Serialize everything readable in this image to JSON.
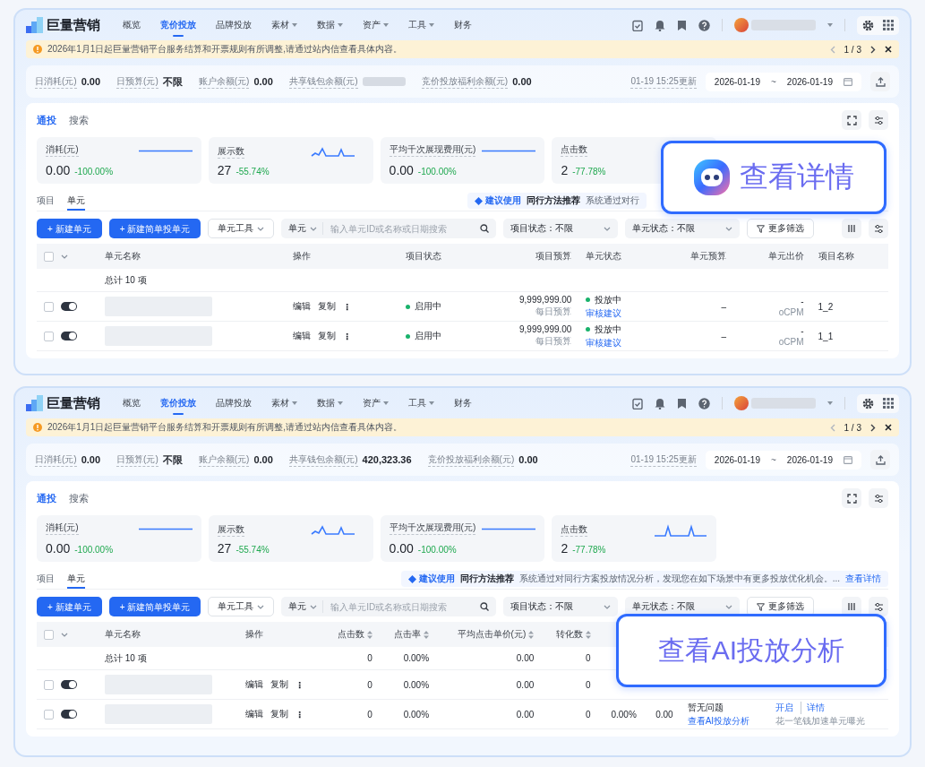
{
  "panels": [
    {
      "nav": {
        "logo": "巨量营销",
        "items": [
          {
            "label": "概览",
            "selected": false,
            "dropdown": false
          },
          {
            "label": "竞价投放",
            "selected": true,
            "dropdown": false
          },
          {
            "label": "品牌投放",
            "selected": false,
            "dropdown": false
          },
          {
            "label": "素材",
            "selected": false,
            "dropdown": true
          },
          {
            "label": "数据",
            "selected": false,
            "dropdown": true
          },
          {
            "label": "资产",
            "selected": false,
            "dropdown": true
          },
          {
            "label": "工具",
            "selected": false,
            "dropdown": true
          },
          {
            "label": "财务",
            "selected": false,
            "dropdown": false
          }
        ]
      },
      "notice": {
        "text": "2026年1月1日起巨量营销平台服务结算和开票规则有所调整,请通过站内信查看具体内容。",
        "pager": "1 / 3"
      },
      "stats": [
        {
          "label": "日消耗(元)",
          "value": "0.00"
        },
        {
          "label": "日预算(元)",
          "value": "不限"
        },
        {
          "label": "账户余额(元)",
          "value": "0.00"
        },
        {
          "label": "共享钱包余额(元)",
          "blurred": true
        },
        {
          "label": "竞价投放福利余额(元)",
          "value": "0.00"
        }
      ],
      "updated": "01-19 15:25更新",
      "date_start": "2026-01-19",
      "date_sep": "~",
      "date_end": "2026-01-19",
      "channel_tabs": [
        {
          "label": "通投",
          "selected": true
        },
        {
          "label": "搜索",
          "selected": false
        }
      ],
      "metrics": [
        {
          "label": "消耗(元)",
          "value": "0.00",
          "change": "-100.00%",
          "kind": "flat"
        },
        {
          "label": "展示数",
          "value": "27",
          "change": "-55.74%",
          "kind": "wave"
        },
        {
          "label": "平均千次展现费用(元)",
          "value": "0.00",
          "change": "-100.00%",
          "kind": "flat"
        },
        {
          "label": "点击数",
          "value": "2",
          "change": "-77.78%"
        }
      ],
      "level_tabs": [
        {
          "label": "项目",
          "selected": false
        },
        {
          "label": "单元",
          "selected": true
        }
      ],
      "suggestion": {
        "tag": "建议使用",
        "title": "同行方法推荐",
        "text": "系统通过对行"
      },
      "toolbar": {
        "primary": [
          "+ 新建单元",
          "+ 新建简单投单元"
        ],
        "tools": "单元工具",
        "scope": "单元",
        "placeholder": "输入单元ID或名称或日期搜索",
        "filters": [
          "项目状态：不限",
          "单元状态：不限"
        ],
        "more": "更多筛选"
      },
      "table": {
        "select_all_checked": false,
        "columns": [
          {
            "label": "单元名称",
            "kind": "name"
          },
          {
            "label": "操作",
            "kind": "ops"
          },
          {
            "label": "项目状态",
            "kind": "text"
          },
          {
            "label": "项目预算",
            "kind": "num"
          },
          {
            "label": "单元状态",
            "kind": "text"
          },
          {
            "label": "单元预算",
            "kind": "num"
          },
          {
            "label": "单元出价",
            "kind": "num"
          },
          {
            "label": "项目名称",
            "kind": "text"
          }
        ],
        "total": {
          "label": "总计 10 项"
        },
        "rows": [
          {
            "checked": false,
            "on": true,
            "cells": [
              {
                "blurred": true
              },
              {
                "links": [
                  "编辑",
                  "复制"
                ],
                "more": "⋮"
              },
              {
                "status": "启用中",
                "color": "#19b26b"
              },
              {
                "main": "9,999,999.00",
                "sub": "每日预算"
              },
              {
                "status": "投放中",
                "color": "#19b26b",
                "link": "审核建议"
              },
              "–",
              {
                "main": "-",
                "sub": "oCPM"
              },
              "1_2"
            ]
          },
          {
            "checked": false,
            "on": true,
            "cells": [
              {
                "blurred": true
              },
              {
                "links": [
                  "编辑",
                  "复制"
                ],
                "more": "⋮"
              },
              {
                "status": "启用中",
                "color": "#19b26b"
              },
              {
                "main": "9,999,999.00",
                "sub": "每日预算"
              },
              {
                "status": "投放中",
                "color": "#19b26b",
                "link": "审核建议"
              },
              "–",
              {
                "main": "-",
                "sub": "oCPM"
              },
              "1_1"
            ]
          }
        ]
      },
      "callout": {
        "text": "查看详情",
        "icon": true
      }
    },
    {
      "nav": {
        "logo": "巨量营销",
        "items": [
          {
            "label": "概览",
            "selected": false,
            "dropdown": false
          },
          {
            "label": "竞价投放",
            "selected": true,
            "dropdown": false
          },
          {
            "label": "品牌投放",
            "selected": false,
            "dropdown": false
          },
          {
            "label": "素材",
            "selected": false,
            "dropdown": true
          },
          {
            "label": "数据",
            "selected": false,
            "dropdown": true
          },
          {
            "label": "资产",
            "selected": false,
            "dropdown": true
          },
          {
            "label": "工具",
            "selected": false,
            "dropdown": true
          },
          {
            "label": "财务",
            "selected": false,
            "dropdown": false
          }
        ]
      },
      "notice": {
        "text": "2026年1月1日起巨量营销平台服务结算和开票规则有所调整,请通过站内信查看具体内容。",
        "pager": "1 / 3"
      },
      "stats": [
        {
          "label": "日消耗(元)",
          "value": "0.00"
        },
        {
          "label": "日预算(元)",
          "value": "不限"
        },
        {
          "label": "账户余额(元)",
          "value": "0.00"
        },
        {
          "label": "共享钱包余额(元)",
          "value": "420,323.36"
        },
        {
          "label": "竞价投放福利余额(元)",
          "value": "0.00"
        }
      ],
      "updated": "01-19 15:25更新",
      "date_start": "2026-01-19",
      "date_sep": "~",
      "date_end": "2026-01-19",
      "channel_tabs": [
        {
          "label": "通投",
          "selected": true
        },
        {
          "label": "搜索",
          "selected": false
        }
      ],
      "metrics": [
        {
          "label": "消耗(元)",
          "value": "0.00",
          "change": "-100.00%",
          "kind": "flat"
        },
        {
          "label": "展示数",
          "value": "27",
          "change": "-55.74%",
          "kind": "wave"
        },
        {
          "label": "平均千次展现费用(元)",
          "value": "0.00",
          "change": "-100.00%",
          "kind": "flat"
        },
        {
          "label": "点击数",
          "value": "2",
          "change": "-77.78%",
          "kind": "peaks"
        }
      ],
      "level_tabs": [
        {
          "label": "项目",
          "selected": false
        },
        {
          "label": "单元",
          "selected": true
        }
      ],
      "suggestion": {
        "tag": "建议使用",
        "title": "同行方法推荐",
        "text": "系统通过对同行方案投放情况分析，发现您在如下场景中有更多投放优化机会。...",
        "link": "查看详情"
      },
      "toolbar": {
        "primary": [
          "+ 新建单元",
          "+ 新建简单投单元"
        ],
        "tools": "单元工具",
        "scope": "单元",
        "placeholder": "输入单元ID或名称或日期搜索",
        "filters": [
          "项目状态：不限",
          "单元状态：不限"
        ],
        "more": "更多筛选"
      },
      "table": {
        "select_all_checked": false,
        "columns": [
          {
            "label": "单元名称",
            "kind": "name"
          },
          {
            "label": "操作",
            "kind": "ops"
          },
          {
            "label": "点击数",
            "kind": "num",
            "sortable": true
          },
          {
            "label": "点击率",
            "kind": "num",
            "sortable": true
          },
          {
            "label": "平均点击单价(元)",
            "kind": "num",
            "sortable": true
          },
          {
            "label": "转化数",
            "kind": "num",
            "sortable": true
          },
          {
            "kind": "num"
          },
          {
            "kind": "num"
          },
          {
            "kind": "text"
          },
          {
            "kind": "text"
          }
        ],
        "total": {
          "label": "总计 10 项",
          "values": [
            "0",
            "0.00%",
            "0.00",
            "0"
          ]
        },
        "rows": [
          {
            "checked": false,
            "on": true,
            "cells": [
              {
                "blurred": true
              },
              {
                "links": [
                  "编辑",
                  "复制"
                ],
                "more": "⋮"
              },
              "0",
              "0.00%",
              "0.00",
              "0"
            ]
          },
          {
            "checked": false,
            "on": true,
            "cells": [
              {
                "blurred": true
              },
              {
                "links": [
                  "编辑",
                  "复制"
                ],
                "more": "⋮"
              },
              "0",
              "0.00%",
              "0.00",
              "0",
              "0.00%",
              "0.00",
              {
                "main": "暂无问题",
                "link": "查看AI投放分析"
              },
              {
                "links": [
                  "开启",
                  "详情"
                ],
                "sub": "花一笔钱加速单元曝光"
              }
            ]
          }
        ]
      },
      "callout": {
        "text": "查看AI投放分析",
        "icon": false
      }
    }
  ]
}
